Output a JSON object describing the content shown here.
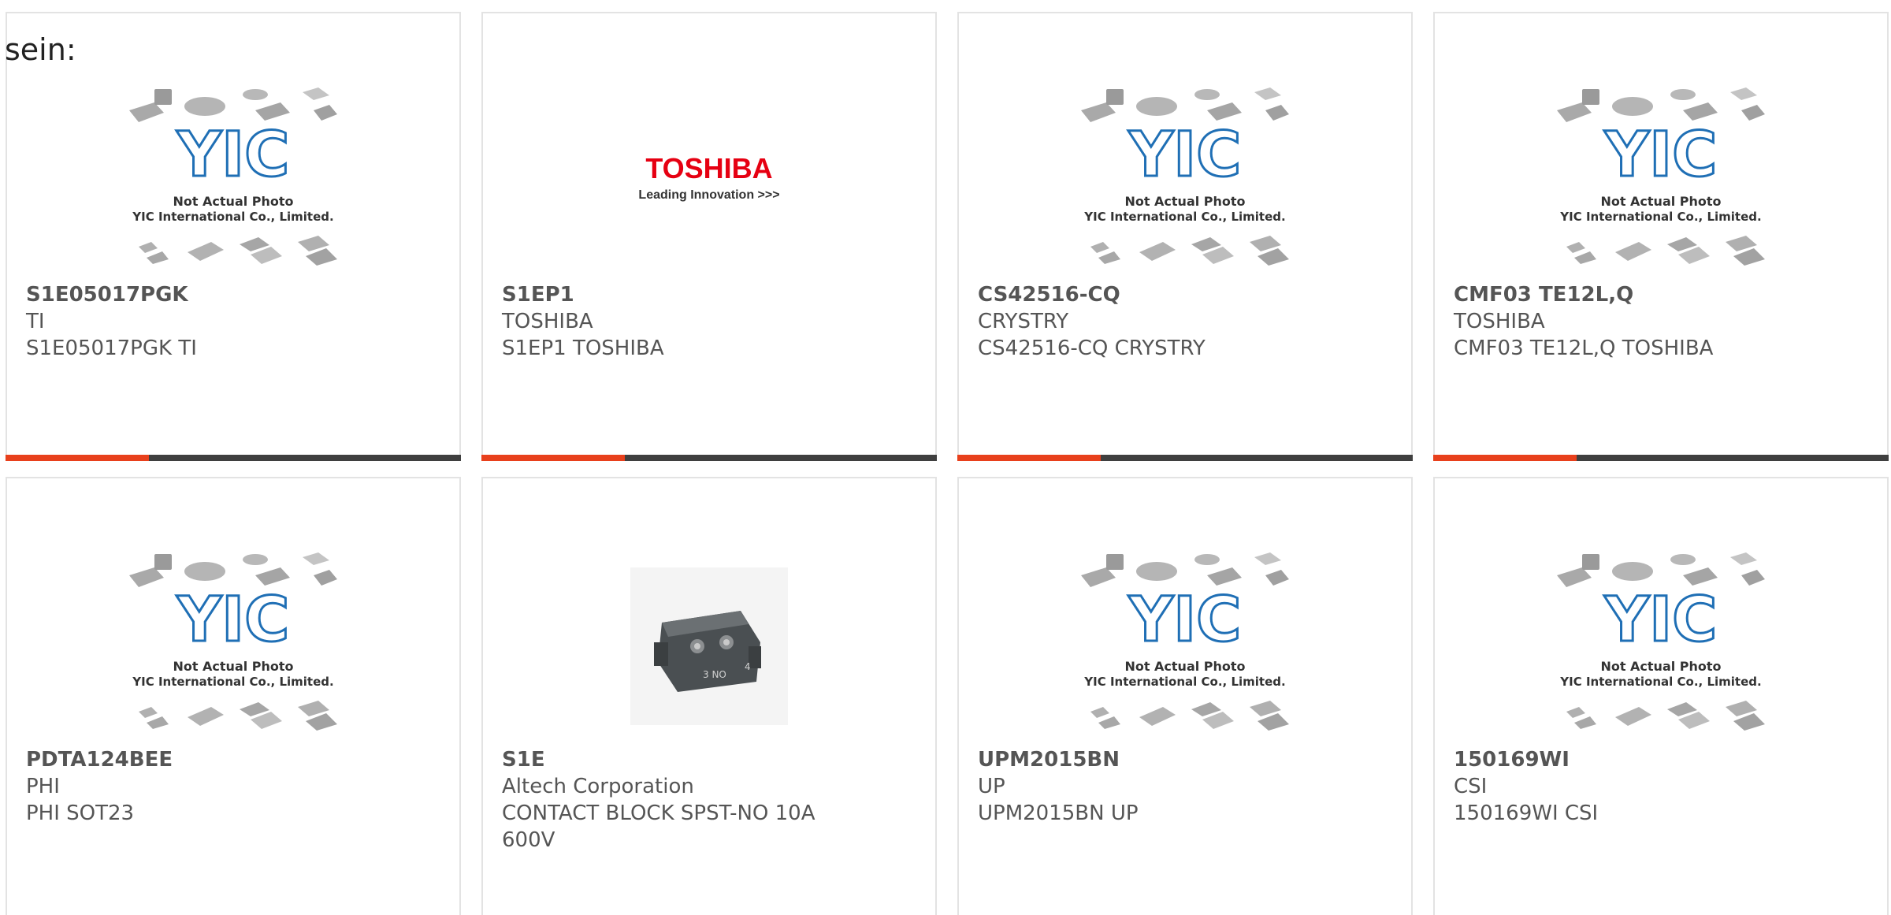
{
  "intro_text": "sein:",
  "placeholder": {
    "logo_text": "YIC",
    "line1": "Not Actual Photo",
    "line2": "YIC International Co., Limited."
  },
  "toshiba_logo": {
    "brand": "TOSHIBA",
    "tagline": "Leading Innovation >>>"
  },
  "contact_block_labels": {
    "left": "3 NO",
    "right": "4"
  },
  "colors": {
    "accent": "#e8401c",
    "bar": "#3f3f3f",
    "text": "#555555",
    "yic_blue": "#1f6fb5",
    "toshiba_red": "#e60012"
  },
  "products": [
    {
      "part": "S1E05017PGK",
      "maker": "TI",
      "desc": "S1E05017PGK TI",
      "image": "yic-placeholder"
    },
    {
      "part": "S1EP1",
      "maker": "TOSHIBA",
      "desc": "S1EP1 TOSHIBA",
      "image": "toshiba-logo"
    },
    {
      "part": "CS42516-CQ",
      "maker": "CRYSTRY",
      "desc": "CS42516-CQ CRYSTRY",
      "image": "yic-placeholder"
    },
    {
      "part": "CMF03 TE12L,Q",
      "maker": "TOSHIBA",
      "desc": "CMF03 TE12L,Q TOSHIBA",
      "image": "yic-placeholder"
    },
    {
      "part": "PDTA124BEE",
      "maker": "PHI",
      "desc": "PHI SOT23",
      "image": "yic-placeholder"
    },
    {
      "part": "S1E",
      "maker": "Altech Corporation",
      "desc": "CONTACT BLOCK SPST-NO 10A 600V",
      "image": "contact-block-photo"
    },
    {
      "part": "UPM2015BN",
      "maker": "UP",
      "desc": "UPM2015BN UP",
      "image": "yic-placeholder"
    },
    {
      "part": "150169WI",
      "maker": "CSI",
      "desc": "150169WI CSI",
      "image": "yic-placeholder"
    }
  ]
}
